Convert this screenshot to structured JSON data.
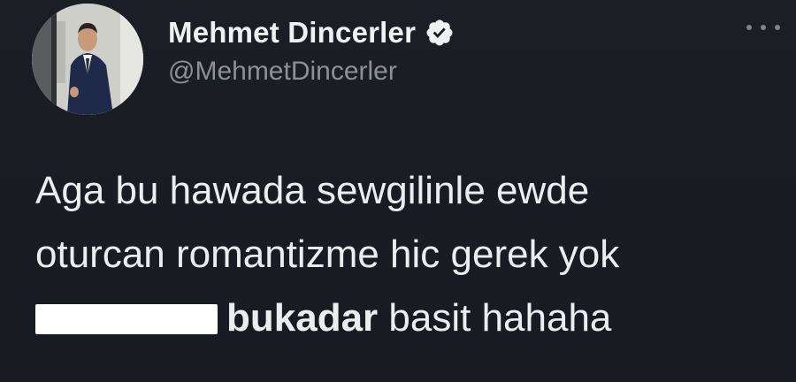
{
  "author": {
    "display_name": "Mehmet Dincerler",
    "handle": "@MehmetDincerler",
    "verified": true
  },
  "tweet": {
    "line1": "Aga bu hawada sewgilinle ewde",
    "line2": "oturcan romantizme hic gerek yok",
    "line3_bold": "bukadar",
    "line3_rest": " basit hahaha"
  },
  "icons": {
    "avatar": "profile-photo",
    "verified": "verified-badge-icon",
    "more": "more-options-icon"
  },
  "colors": {
    "background": "#1a1d23",
    "text": "#ecedef",
    "secondary_text": "#8b9199",
    "redaction": "#ffffff"
  }
}
